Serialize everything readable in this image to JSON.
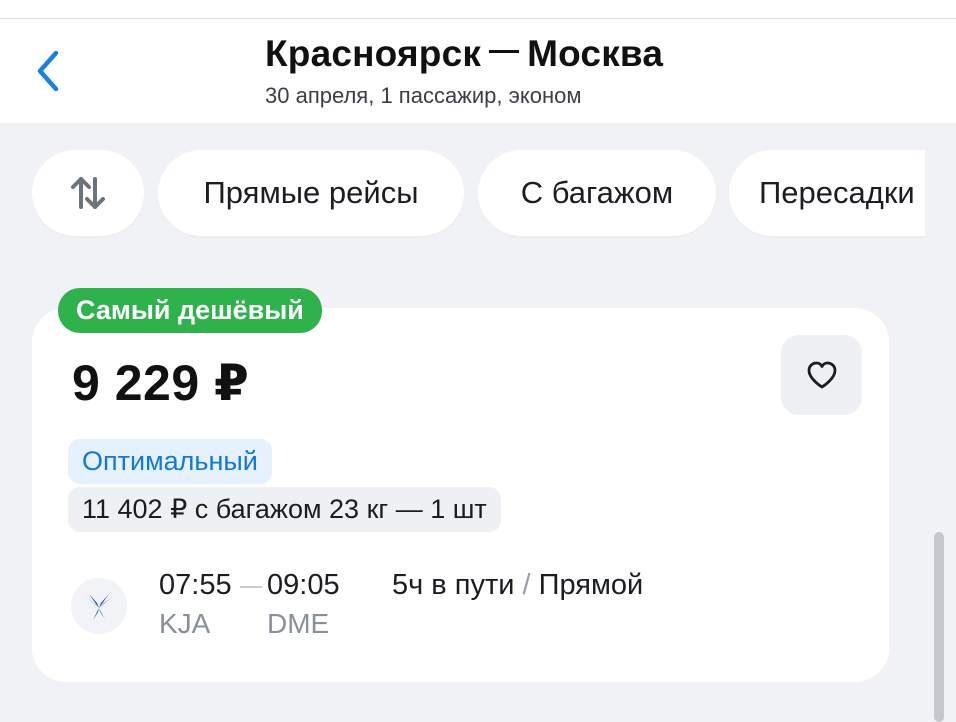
{
  "header": {
    "title_from": "Красноярск",
    "title_to": "Москва",
    "subtitle": "30 апреля, 1 пассажир, эконом",
    "back_icon": "chevron-left-icon"
  },
  "filters": {
    "sort_icon": "sort-arrows-icon",
    "chips": [
      "Прямые рейсы",
      "С багажом",
      "Пересадки"
    ]
  },
  "offer": {
    "badge": "Самый дешёвый",
    "price": "9 229 ₽",
    "tag_optimal": "Оптимальный",
    "baggage_price": "11 402 ₽ с багажом 23 кг — 1 шт",
    "favorite_icon": "heart-icon",
    "flight": {
      "departure_time": "07:55",
      "arrival_time": "09:05",
      "departure_code": "KJA",
      "arrival_code": "DME",
      "duration": "5ч в пути",
      "separator": "/",
      "type": "Прямой"
    }
  },
  "colors": {
    "accent_blue": "#1479d6",
    "badge_green": "#2fb24c",
    "background": "#f0f2f5"
  }
}
